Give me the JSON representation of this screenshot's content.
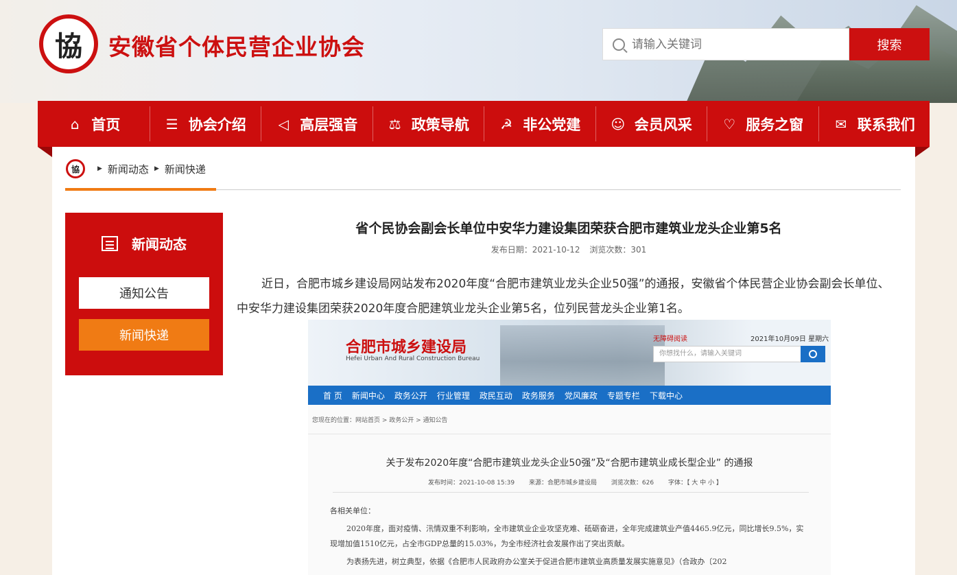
{
  "header": {
    "logo_text": "協",
    "site_title": "安徽省个体民营企业协会",
    "search_placeholder": "请输入关键词",
    "search_button": "搜索"
  },
  "nav": {
    "items": [
      {
        "label": "首页",
        "icon": "home-icon"
      },
      {
        "label": "协会介绍",
        "icon": "document-icon"
      },
      {
        "label": "高层强音",
        "icon": "megaphone-icon"
      },
      {
        "label": "政策导航",
        "icon": "scale-icon"
      },
      {
        "label": "非公党建",
        "icon": "party-emblem-icon"
      },
      {
        "label": "会员风采",
        "icon": "user-icon"
      },
      {
        "label": "服务之窗",
        "icon": "heart-hand-icon"
      },
      {
        "label": "联系我们",
        "icon": "chat-icon"
      }
    ]
  },
  "breadcrumb": {
    "home_logo": "協",
    "items": [
      "新闻动态",
      "新闻快递"
    ]
  },
  "sidebar": {
    "title": "新闻动态",
    "links": [
      "通知公告",
      "新闻快递"
    ]
  },
  "article": {
    "title": "省个民协会副会长单位中安华力建设集团荣获合肥市建筑业龙头企业第5名",
    "publish_date": "发布日期：2021-10-12",
    "views": "浏览次数：301",
    "body": "近日，合肥市城乡建设局网站发布2020年度“合肥市建筑业龙头企业50强”的通报，安徽省个体民营企业协会副会长单位、中安华力建设集团荣获2020年度合肥建筑业龙头企业第5名，位列民营龙头企业第1名。"
  },
  "embedded": {
    "logo": "合肥市城乡建设局",
    "logo_en": "Hefei Urban And Rural Construction Bureau",
    "accessibility": "无障碍阅读",
    "date": "2021年10月09日 星期六",
    "search_placeholder": "你想找什么，请输入关键词",
    "nav": [
      "首 页",
      "新闻中心",
      "政务公开",
      "行业管理",
      "政民互动",
      "政务服务",
      "党风廉政",
      "专题专栏",
      "下载中心"
    ],
    "crumb": "您现在的位置：网站首页 > 政务公开 > 通知公告",
    "title": "关于发布2020年度“合肥市建筑业龙头企业50强”及“合肥市建筑业成长型企业” 的通报",
    "meta_time": "发布时间：2021-10-08 15:39",
    "meta_source": "来源：合肥市城乡建设局",
    "meta_views": "浏览次数：626",
    "meta_font": "字体：【 大 中 小 】",
    "text1": "各相关单位：",
    "text2": "2020年度，面对疫情、汛情双重不利影响，全市建筑业企业攻坚克难、砥砺奋进，全年完成建筑业产值4465.9亿元，同比增长9.5%，实现增加值1510亿元，占全市GDP总量的15.03%，为全市经济社会发展作出了突出贡献。",
    "text3": "为表扬先进，树立典型，依据《合肥市人民政府办公室关于促进合肥市建筑业高质量发展实施意见》（合政办〔202"
  },
  "colors": {
    "brand_red": "#cc0d0d",
    "accent_orange": "#f07b14",
    "embedded_blue": "#1a6fc6"
  }
}
